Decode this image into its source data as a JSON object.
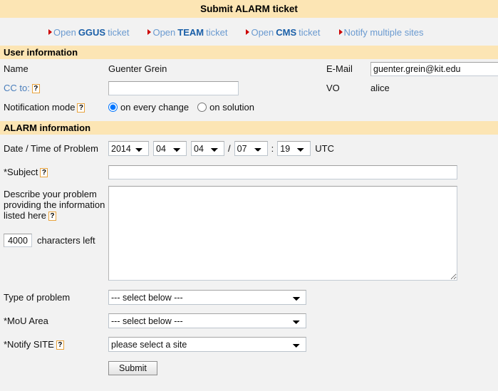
{
  "header": {
    "title": "Submit ALARM ticket"
  },
  "quicklinks": [
    {
      "name": "open-ggus-ticket",
      "pre": "Open",
      "strong": "GGUS",
      "post": "ticket"
    },
    {
      "name": "open-team-ticket",
      "pre": "Open",
      "strong": "TEAM",
      "post": "ticket"
    },
    {
      "name": "open-cms-ticket",
      "pre": "Open",
      "strong": "CMS",
      "post": "ticket"
    },
    {
      "name": "notify-multiple-sites",
      "pre": "Notify multiple sites",
      "strong": "",
      "post": ""
    }
  ],
  "user_information": {
    "section_title": "User information",
    "name_label": "Name",
    "name_value": "Guenter Grein",
    "email_label": "E-Mail",
    "email_value": "guenter.grein@kit.edu",
    "cc_label": "CC to:",
    "cc_value": "",
    "vo_label": "VO",
    "vo_value": "alice",
    "notification_label": "Notification mode",
    "notification_options": [
      "on every change",
      "on solution"
    ],
    "notification_selected": "on every change",
    "help_glyph": "?"
  },
  "alarm_information": {
    "section_title": "ALARM information",
    "datetime_label": "Date / Time of Problem",
    "date_year": "2014",
    "date_month": "04",
    "date_day": "04",
    "time_hour": "07",
    "time_minute": "19",
    "date_separator": "/",
    "time_separator": ":",
    "timezone": "UTC",
    "subject_label": "*Subject",
    "subject_value": "",
    "describe_label": "Describe your problem providing the information listed here",
    "describe_value": "",
    "characters_left_count": "4000",
    "characters_left_label": "characters left",
    "type_of_problem_label": "Type of problem",
    "type_of_problem_value": "--- select below ---",
    "mou_area_label": "*MoU Area",
    "mou_area_value": "--- select below ---",
    "notify_site_label": "*Notify SITE",
    "notify_site_value": "please select a site",
    "submit_label": "Submit"
  },
  "colors": {
    "header_bg": "#fce5b4",
    "page_bg": "#f2f2f2",
    "link_blue": "#4a7ebb",
    "bullet_red": "#cc0000",
    "help_border": "#e8a33d"
  }
}
